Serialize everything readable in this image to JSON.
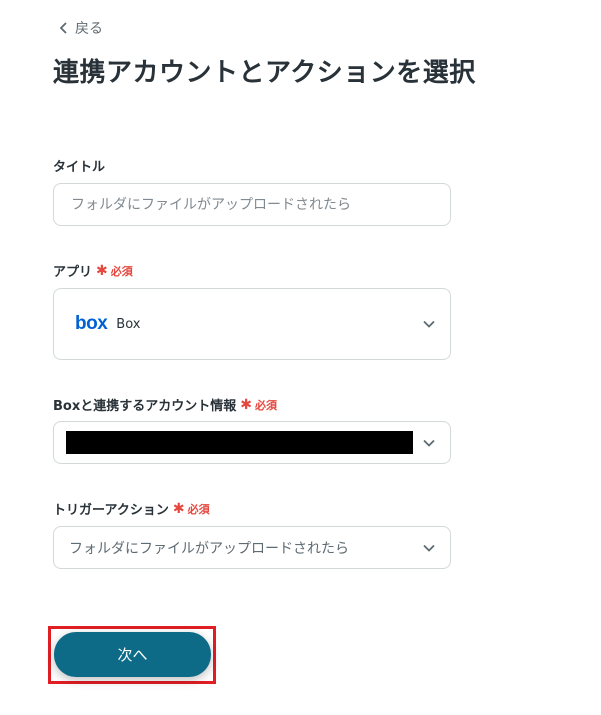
{
  "nav": {
    "back_label": "戻る"
  },
  "page_title": "連携アカウントとアクションを選択",
  "required_label": "必須",
  "fields": {
    "title": {
      "label": "タイトル",
      "value": "",
      "placeholder": "フォルダにファイルがアップロードされたら"
    },
    "app": {
      "label": "アプリ",
      "logo_text": "box",
      "value": "Box"
    },
    "account": {
      "label": "Boxと連携するアカウント情報",
      "value": "[redacted]"
    },
    "trigger": {
      "label": "トリガーアクション",
      "value": "フォルダにファイルがアップロードされたら"
    }
  },
  "actions": {
    "next_label": "次へ"
  },
  "colors": {
    "accent": "#0e6b88",
    "required": "#e5473e",
    "highlight": "#e01e24",
    "box_brand": "#0061d5"
  }
}
